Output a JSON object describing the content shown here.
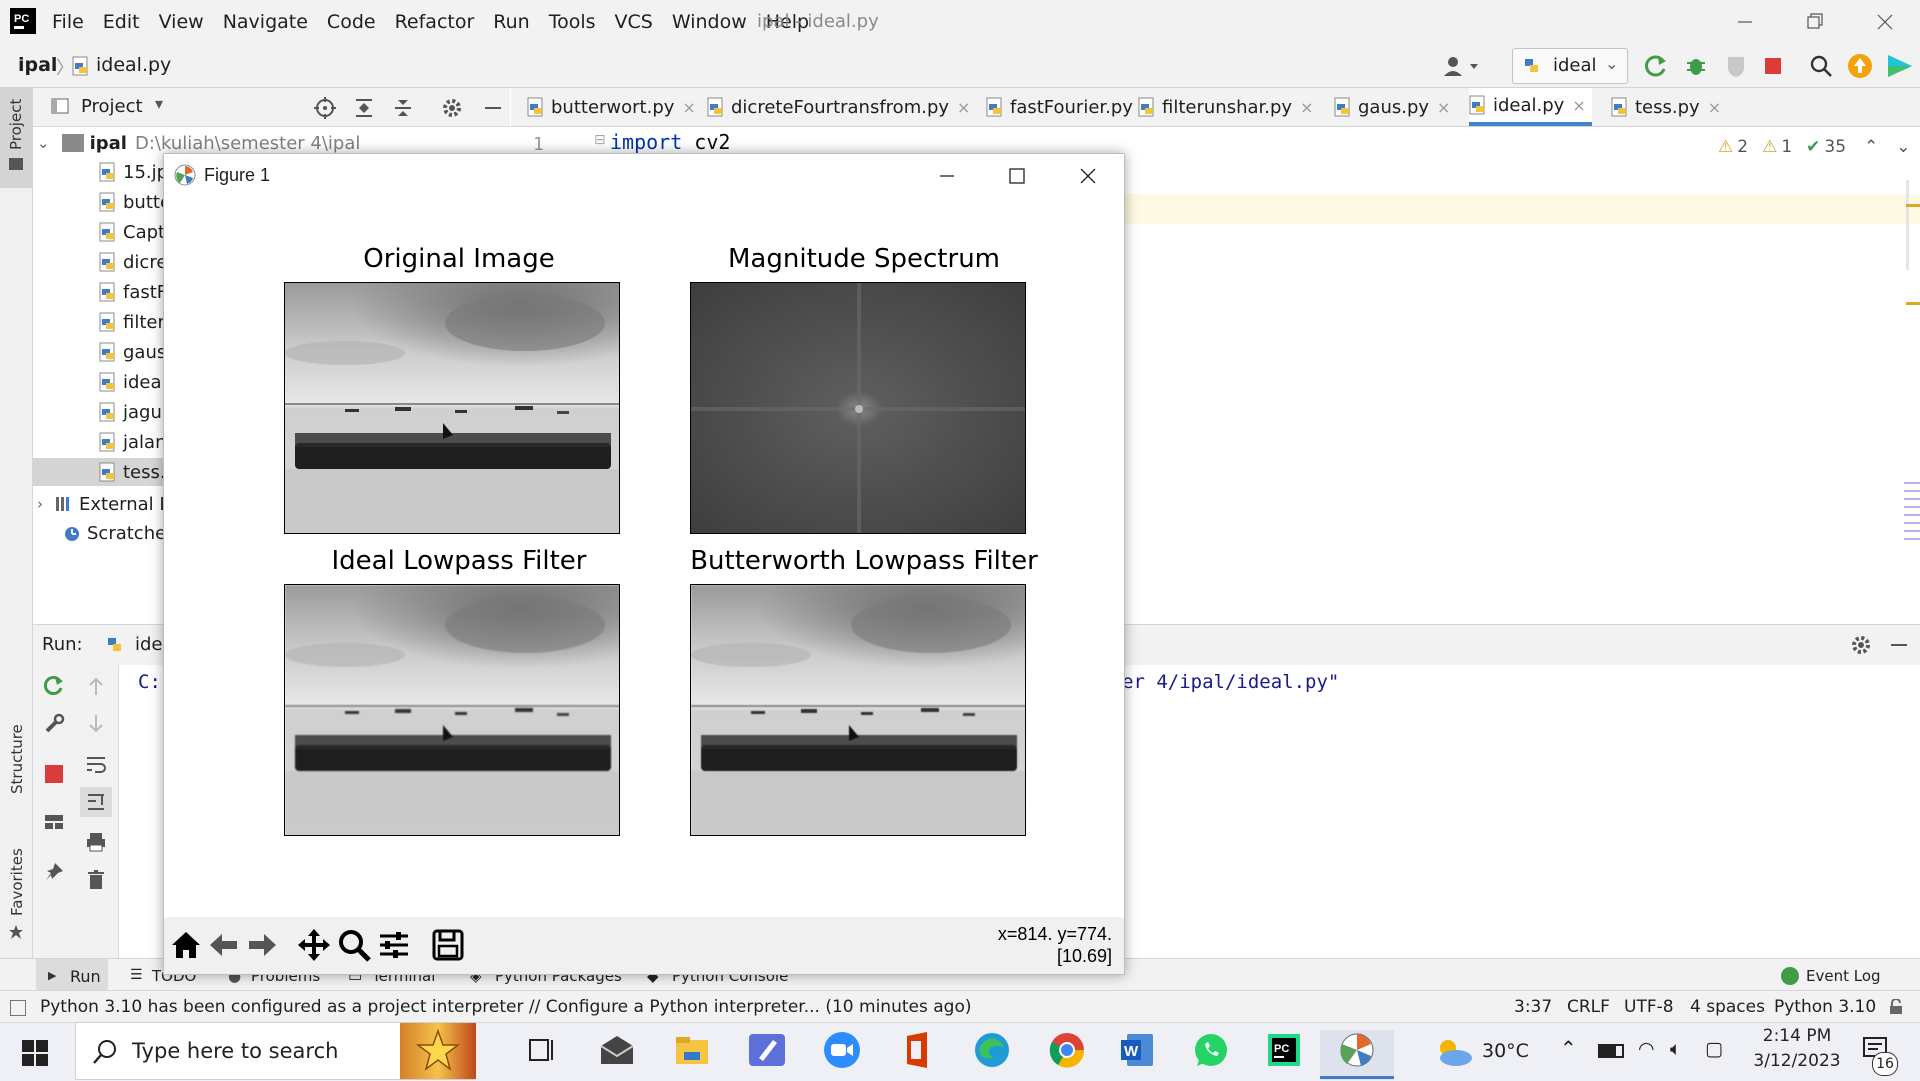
{
  "ide": {
    "menu": [
      "File",
      "Edit",
      "View",
      "Navigate",
      "Code",
      "Refactor",
      "Run",
      "Tools",
      "VCS",
      "Window",
      "Help"
    ],
    "window_title": "ipal - ideal.py",
    "breadcrumb": {
      "project": "ipal",
      "file": "ideal.py"
    },
    "run_config": "ideal"
  },
  "sidebar": {
    "project_label": "Project",
    "structure_label": "Structure",
    "favorites_label": "Favorites"
  },
  "project_panel": {
    "title": "Project",
    "root": {
      "name": "ipal",
      "path": "D:\\kuliah\\semester 4\\ipal"
    },
    "files": [
      "15.jp",
      "butte",
      "Captu",
      "dicre",
      "fastF",
      "filteru",
      "gaus.",
      "ideal.",
      "jagur",
      "jalan.",
      "tess.p"
    ],
    "external": "External L",
    "scratches": "Scratches"
  },
  "editor": {
    "tabs": [
      {
        "label": "butterwort.py"
      },
      {
        "label": "dicreteFourtransfrom.py"
      },
      {
        "label": "fastFourier.py"
      },
      {
        "label": "filterunshar.py"
      },
      {
        "label": "gaus.py"
      },
      {
        "label": "ideal.py",
        "active": true
      },
      {
        "label": "tess.py"
      }
    ],
    "line_number": "1",
    "code_keyword": "import",
    "code_rest": " cv2",
    "inspections": {
      "warnings": "2",
      "weak": "1",
      "typos": "35"
    }
  },
  "run_panel": {
    "label": "Run:",
    "tab": "idea",
    "console_prefix": "C:",
    "console_suffix": "er 4/ipal/ideal.py\""
  },
  "bottom_tabs": [
    "Run",
    "TODO",
    "Problems",
    "Terminal",
    "Python Packages",
    "Python Console"
  ],
  "event_log": "Event Log",
  "status": {
    "message": "Python 3.10 has been configured as a project interpreter // Configure a Python interpreter... (10 minutes ago)",
    "position": "3:37",
    "line_sep": "CRLF",
    "encoding": "UTF-8",
    "indent": "4 spaces",
    "interpreter": "Python 3.10"
  },
  "figure": {
    "window_title": "Figure 1",
    "plots": [
      {
        "title": "Original Image"
      },
      {
        "title": "Magnitude Spectrum"
      },
      {
        "title": "Ideal Lowpass Filter"
      },
      {
        "title": "Butterworth Lowpass Filter"
      }
    ],
    "coords": "x=814. y=774.",
    "value": "[10.69]",
    "toolbar": [
      "home-icon",
      "back-icon",
      "forward-icon",
      "pan-icon",
      "zoom-icon",
      "configure-icon",
      "save-icon"
    ]
  },
  "taskbar": {
    "search_placeholder": "Type here to search",
    "weather": "30°C",
    "time": "2:14 PM",
    "date": "3/12/2023",
    "notifications": "16"
  },
  "colors": {
    "accent": "#4083c9",
    "figure_bg": "#ffffff",
    "warning": "#e0a526",
    "stop_red": "#db3b3b"
  }
}
